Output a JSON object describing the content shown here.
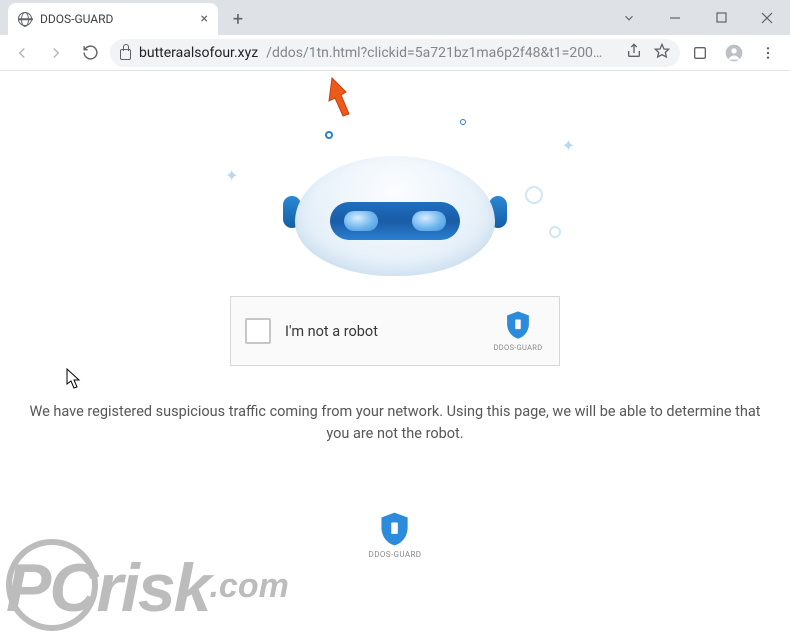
{
  "tab": {
    "title": "DDOS-GUARD"
  },
  "url": {
    "host": "butteraalsofour.xyz",
    "rest": "/ddos/1tn.html?clickid=5a721bz1ma6p2f48&t1=200…"
  },
  "captcha": {
    "label": "I'm not a robot",
    "brand": "DDOS-GUARD"
  },
  "message": "We have registered suspicious traffic coming from your network. Using this page, we will be able to determine that you are not the robot.",
  "footer_brand": "DDOS-GUARD",
  "watermark": {
    "pc": "PC",
    "risk": "risk",
    "dotcom": ".com"
  }
}
